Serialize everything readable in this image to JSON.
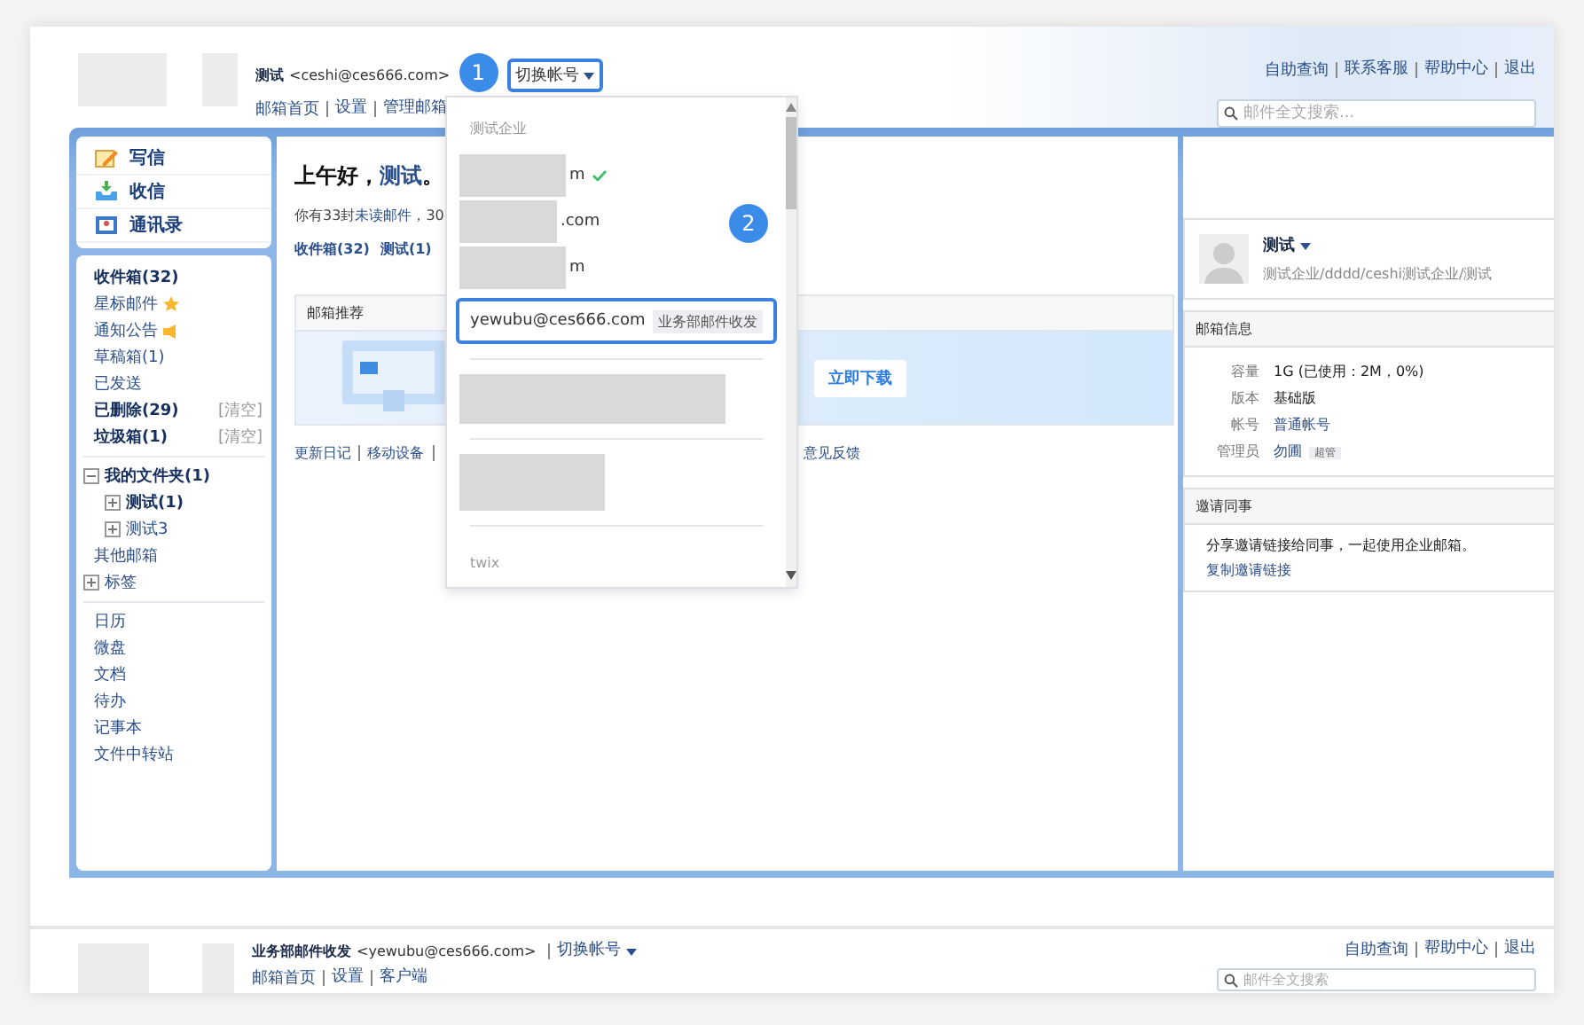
{
  "header": {
    "user_name": "测试",
    "user_email": "<ceshi@ces666.com>",
    "switch_label": "切换帐号",
    "switch_highlighted": true,
    "step": "1",
    "links": [
      "邮箱首页",
      "设置",
      "管理邮箱"
    ]
  },
  "top_links": [
    "自助查询",
    "联系客服",
    "帮助中心",
    "退出"
  ],
  "search": {
    "placeholder": "邮件全文搜索..."
  },
  "sidebar": {
    "actions": [
      {
        "label": "写信",
        "kind": "compose"
      },
      {
        "label": "收信",
        "kind": "receive"
      },
      {
        "label": "通讯录",
        "kind": "contacts"
      }
    ],
    "folders": [
      {
        "label": "收件箱(32)",
        "bold": true,
        "kind": "plain"
      },
      {
        "label": "星标邮件",
        "bold": false,
        "kind": "star"
      },
      {
        "label": "通知公告",
        "bold": false,
        "kind": "notice"
      },
      {
        "label": "草稿箱(1)",
        "bold": false,
        "kind": "plain"
      },
      {
        "label": "已发送",
        "bold": false,
        "kind": "plain"
      },
      {
        "label": "已删除(29)",
        "bold": true,
        "kind": "clear",
        "action": "[清空]"
      },
      {
        "label": "垃圾箱(1)",
        "bold": true,
        "kind": "clear",
        "action": "[清空]"
      }
    ],
    "tree": [
      {
        "label": "我的文件夹(1)",
        "bold": true,
        "expanded": true,
        "children": [
          {
            "label": "测试(1)",
            "bold": true,
            "expanded": false
          },
          {
            "label": "测试3",
            "bold": false,
            "expanded": false
          }
        ]
      },
      {
        "label": "其他邮箱",
        "bold": false
      },
      {
        "label": "标签",
        "bold": false,
        "expanded": false
      }
    ],
    "apps": [
      "日历",
      "微盘",
      "文档",
      "待办",
      "记事本",
      "文件中转站"
    ]
  },
  "main": {
    "greeting": "上午好，",
    "greeting_name": "测试",
    "greeting_end": "。",
    "unread_prefix": "你有33封",
    "unread_link": "未读邮件",
    "unread_suffix": "，30",
    "quick_links": [
      "收件箱(32)",
      "测试(1)"
    ],
    "recommend": {
      "title": "邮箱推荐",
      "button": "立即下载"
    },
    "footer_links": [
      "更新日记",
      "移动设备"
    ],
    "feedback_link": "意见反馈"
  },
  "dropdown": {
    "group_label": "测试企业",
    "step": "2",
    "accounts": [
      {
        "kind": "redacted",
        "email": "m",
        "selected": true,
        "highlighted": false
      },
      {
        "kind": "redacted",
        "email": ".com",
        "selected": false,
        "highlighted": false
      },
      {
        "kind": "redacted",
        "email": "m",
        "selected": false,
        "highlighted": false
      },
      {
        "kind": "full",
        "email": "yewubu@ces666.com",
        "tag": "业务部邮件收发",
        "selected": false,
        "highlighted": true
      }
    ],
    "second_group_label": "twix"
  },
  "profile": {
    "name": "测试",
    "org": "测试企业/dddd/ceshi测试企业/测试"
  },
  "mailbox_info": {
    "title": "邮箱信息",
    "rows": [
      {
        "label": "容量",
        "value": "1G (已使用：2M，0%)",
        "kind": "text"
      },
      {
        "label": "版本",
        "value": "基础版",
        "kind": "text"
      },
      {
        "label": "帐号",
        "value": "普通帐号",
        "kind": "link"
      },
      {
        "label": "管理员",
        "value": "勿圃",
        "kind": "link",
        "badge": "超管"
      }
    ]
  },
  "invite": {
    "title": "邀请同事",
    "text": "分享邀请链接给同事，一起使用企业邮箱。",
    "link": "复制邀请链接"
  },
  "second_account": {
    "user_name": "业务部邮件收发",
    "user_email": "<yewubu@ces666.com>",
    "switch_label": "切换帐号",
    "links": [
      "邮箱首页",
      "设置",
      "客户端"
    ],
    "top_links": [
      "自助查询",
      "帮助中心",
      "退出"
    ],
    "search_placeholder": "邮件全文搜索"
  }
}
